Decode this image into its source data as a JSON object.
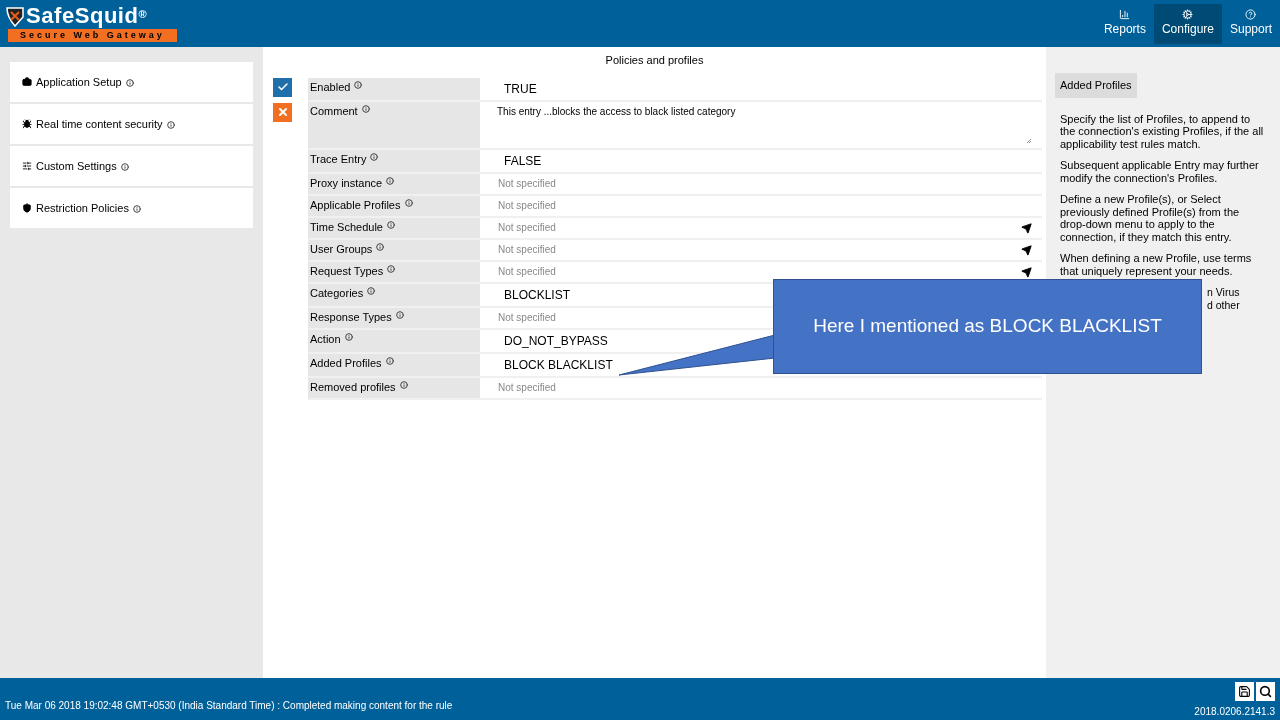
{
  "brand": {
    "name": "SafeSquid",
    "mark": "®",
    "tagline": "Secure Web Gateway"
  },
  "nav": [
    {
      "label": "Reports",
      "selected": false
    },
    {
      "label": "Configure",
      "selected": true
    },
    {
      "label": "Support",
      "selected": false
    }
  ],
  "sidebar": {
    "items": [
      {
        "label": "Application Setup"
      },
      {
        "label": "Real time content security"
      },
      {
        "label": "Custom Settings"
      },
      {
        "label": "Restriction Policies"
      }
    ]
  },
  "main": {
    "title": "Policies and profiles",
    "fields": [
      {
        "label": "Enabled",
        "kind": "value",
        "value": "TRUE",
        "picker": false
      },
      {
        "label": "Comment",
        "kind": "comment",
        "value": "This entry ...blocks the access to black listed category",
        "picker": false
      },
      {
        "label": "Trace Entry",
        "kind": "value",
        "value": "FALSE",
        "picker": false
      },
      {
        "label": "Proxy instance",
        "kind": "empty",
        "placeholder": "Not specified",
        "picker": false
      },
      {
        "label": "Applicable Profiles",
        "kind": "empty",
        "placeholder": "Not specified",
        "picker": false
      },
      {
        "label": "Time Schedule",
        "kind": "empty",
        "placeholder": "Not specified",
        "picker": true
      },
      {
        "label": "User Groups",
        "kind": "empty",
        "placeholder": "Not specified",
        "picker": true
      },
      {
        "label": "Request Types",
        "kind": "empty",
        "placeholder": "Not specified",
        "picker": true
      },
      {
        "label": "Categories",
        "kind": "value",
        "value": "BLOCKLIST"
      },
      {
        "label": "Response Types",
        "kind": "empty",
        "placeholder": "Not specified"
      },
      {
        "label": "Action",
        "kind": "value",
        "value": "DO_NOT_BYPASS"
      },
      {
        "label": "Added Profiles",
        "kind": "value",
        "value": "BLOCK BLACKLIST"
      },
      {
        "label": "Removed profiles",
        "kind": "empty",
        "placeholder": "Not specified",
        "picker": false
      }
    ]
  },
  "help": {
    "title": "Added Profiles",
    "paragraphs": [
      "Specify the list of Profiles, to append to the connection's existing Profiles, if the all applicability test rules match.",
      "Subsequent applicable Entry may further modify the connection's Profiles.",
      "Define a new Profile(s), or Select previously defined Profile(s) from the drop-down menu to apply to the connection, if they match this entry.",
      "When defining a new Profile, use terms that uniquely represent your needs."
    ],
    "fragments": [
      "n Virus",
      "d other"
    ]
  },
  "callout": {
    "text": "Here I mentioned as BLOCK BLACKLIST"
  },
  "status_bar": {
    "message": "Tue Mar 06 2018 19:02:48 GMT+0530 (India Standard Time) : Completed making content for the rule",
    "version": "2018.0206.2141.3"
  }
}
